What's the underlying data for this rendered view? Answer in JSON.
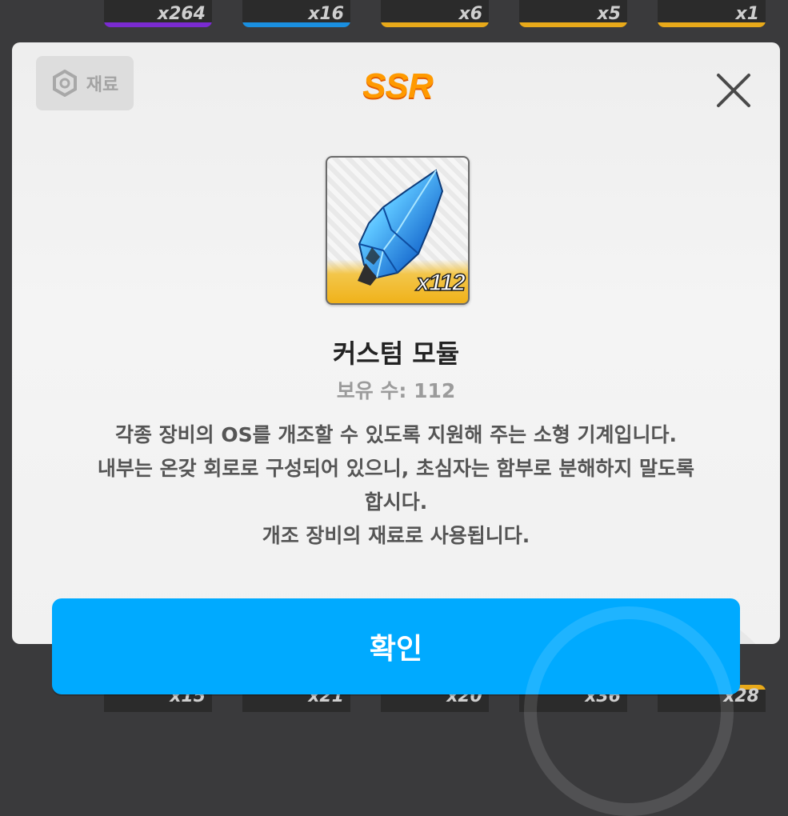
{
  "background": {
    "top_counts": [
      "x264",
      "x16",
      "x6",
      "x5",
      "x1"
    ],
    "bottom_counts": [
      "x15",
      "x21",
      "x20",
      "x36",
      "x28"
    ]
  },
  "dialog": {
    "category_label": "재료",
    "rarity": "SSR",
    "item": {
      "name": "커스텀 모듈",
      "quantity_badge": "x112",
      "owned_label": "보유 수: 112",
      "description_lines": [
        "각종 장비의 OS를 개조할 수 있도록 지원해 주는 소형 기계입니다.",
        "내부는 온갖 회로로 구성되어 있으니, 초심자는 함부로 분해하지 말도록",
        "합시다.",
        "개조 장비의 재료로 사용됩니다."
      ]
    },
    "confirm_label": "확인",
    "colors": {
      "rarity": "#ff9a00",
      "confirm_button": "#00aaff",
      "rarity_stripe": "#f0b21a"
    }
  }
}
